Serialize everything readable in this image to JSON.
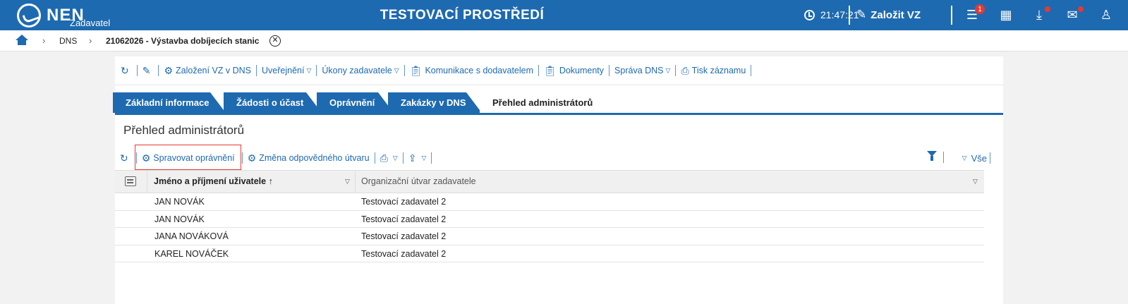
{
  "header": {
    "logo_text": "NEN",
    "logo_sub": "Zadavatel",
    "env_title": "TESTOVACÍ PROSTŘEDÍ",
    "clock": "21:47:21",
    "create_vz_label": "Založit VZ",
    "menu_badge": "1"
  },
  "breadcrumb": {
    "dns": "DNS",
    "current": "21062026 - Výstavba dobíjecích stanic"
  },
  "actions": {
    "zalozeni": "Založení VZ v DNS",
    "uverejneni": "Uveřejnění",
    "ukony": "Úkony zadavatele",
    "komunikace": "Komunikace s dodavatelem",
    "dokumenty": "Dokumenty",
    "sprava_dns": "Správa DNS",
    "tisk": "Tisk záznamu"
  },
  "tabs": [
    {
      "label": "Základní informace"
    },
    {
      "label": "Žádosti o účast"
    },
    {
      "label": "Oprávnění"
    },
    {
      "label": "Zakázky v DNS"
    },
    {
      "label": "Přehled administrátorů"
    }
  ],
  "section_title": "Přehled administrátorů",
  "grid_toolbar": {
    "manage_permissions": "Spravovat oprávnění",
    "change_unit": "Změna odpovědného útvaru",
    "all_label": "Vše"
  },
  "table": {
    "columns": [
      "Jméno a příjmení uživatele",
      "Organizační útvar zadavatele"
    ],
    "rows": [
      [
        "JAN NOVÁK",
        "Testovací zadavatel 2"
      ],
      [
        "JAN NOVÁK",
        "Testovací zadavatel 2"
      ],
      [
        "JANA NOVÁKOVÁ",
        "Testovací zadavatel 2"
      ],
      [
        "KAREL NOVÁČEK",
        "Testovací zadavatel 2"
      ]
    ]
  },
  "colors": {
    "brand": "#1e6ab0",
    "highlight": "#e53935"
  }
}
